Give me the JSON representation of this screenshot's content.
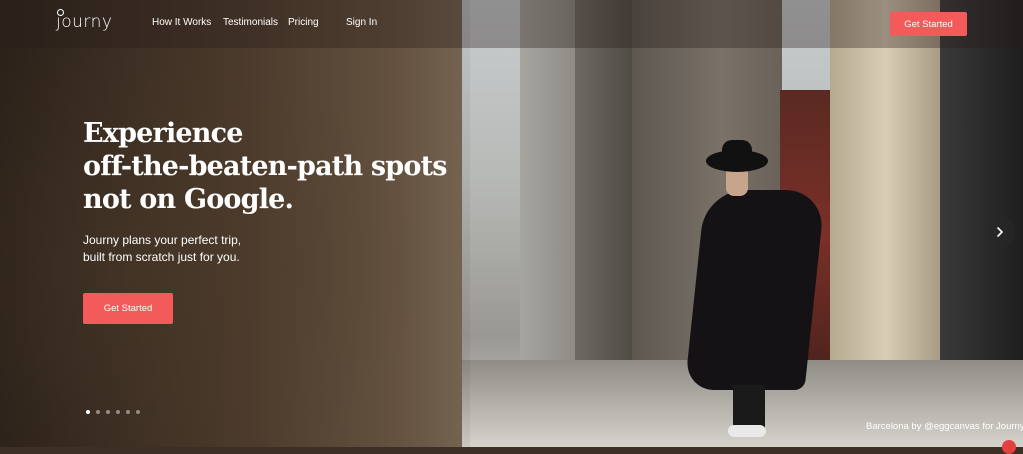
{
  "brand": {
    "logo_text": "journy"
  },
  "nav": {
    "items": [
      {
        "label": "How It Works"
      },
      {
        "label": "Testimonials"
      },
      {
        "label": "Pricing"
      },
      {
        "label": "Sign In"
      }
    ],
    "cta_label": "Get Started"
  },
  "hero": {
    "title_lines": [
      "Experience",
      "off-the-beaten-path spots",
      "not on Google."
    ],
    "subtitle_lines": [
      "Journy plans your perfect trip,",
      "built from scratch just for you."
    ],
    "cta_label": "Get Started"
  },
  "carousel": {
    "slide_count": 6,
    "active_index": 0,
    "next_icon": "chevron-right-icon"
  },
  "photo_credit": "Barcelona by @eggcanvas for Journy",
  "colors": {
    "accent": "#f35b5b"
  }
}
